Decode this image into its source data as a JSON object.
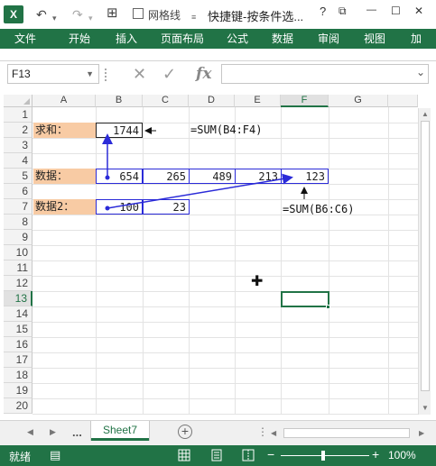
{
  "titlebar": {
    "logo": "X",
    "undo_icon": "undo-arrow-icon",
    "redo_icon": "redo-arrow-icon",
    "gridlines_label": "网格线",
    "title": "快捷键-按条件选...",
    "help": "?",
    "restore": "⧉",
    "minimize": "—",
    "maximize": "☐",
    "close": "✕"
  },
  "ribbon": {
    "tabs": [
      "文件",
      "开始",
      "插入",
      "页面布局",
      "公式",
      "数据",
      "审阅",
      "视图",
      "加"
    ]
  },
  "formula_bar": {
    "name_box": "F13",
    "formula": ""
  },
  "grid": {
    "columns": [
      "A",
      "B",
      "C",
      "D",
      "E",
      "F",
      "G"
    ],
    "rows": [
      "1",
      "2",
      "3",
      "4",
      "5",
      "6",
      "7",
      "8",
      "9",
      "10",
      "11",
      "12",
      "13",
      "14",
      "15",
      "16",
      "17",
      "18",
      "19",
      "20"
    ],
    "selected_col": "F",
    "selected_row": "13",
    "cells": {
      "a2": "求和：",
      "b2": "1744",
      "a5": "数据：",
      "b5": "654",
      "c5": "265",
      "d5": "489",
      "e5": "213",
      "f5": "123",
      "a7": "数据2：",
      "b7": "100",
      "c7": "23"
    },
    "annotations": {
      "sum_formula": "=SUM(B4:F4)",
      "sum_formula2": "=SUM(B6:C6)"
    }
  },
  "sheets": {
    "dots": "...",
    "active": "Sheet7",
    "add": "+"
  },
  "status": {
    "ready": "就绪",
    "zoom_minus": "−",
    "zoom_plus": "+",
    "zoom": "100%"
  },
  "colors": {
    "accent": "#217346",
    "label_fill": "#f8cba4",
    "box_border": "#2b2bd8"
  }
}
